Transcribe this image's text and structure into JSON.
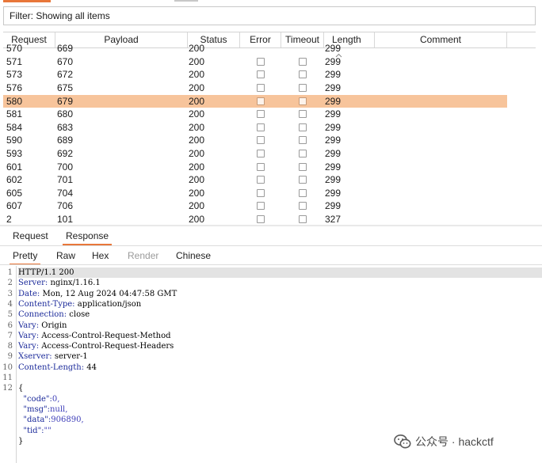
{
  "filter": {
    "label": "Filter: Showing all items"
  },
  "table": {
    "columns": [
      "Request",
      "Payload",
      "Status",
      "Error",
      "Timeout",
      "Length",
      "Comment"
    ],
    "sort_column": "Length",
    "partial_row": {
      "request": "570",
      "payload": "669",
      "status": "200",
      "length": "299"
    },
    "rows": [
      {
        "request": "571",
        "payload": "670",
        "status": "200",
        "error": false,
        "timeout": false,
        "length": "299",
        "selected": false
      },
      {
        "request": "573",
        "payload": "672",
        "status": "200",
        "error": false,
        "timeout": false,
        "length": "299",
        "selected": false
      },
      {
        "request": "576",
        "payload": "675",
        "status": "200",
        "error": false,
        "timeout": false,
        "length": "299",
        "selected": false
      },
      {
        "request": "580",
        "payload": "679",
        "status": "200",
        "error": false,
        "timeout": false,
        "length": "299",
        "selected": true
      },
      {
        "request": "581",
        "payload": "680",
        "status": "200",
        "error": false,
        "timeout": false,
        "length": "299",
        "selected": false
      },
      {
        "request": "584",
        "payload": "683",
        "status": "200",
        "error": false,
        "timeout": false,
        "length": "299",
        "selected": false
      },
      {
        "request": "590",
        "payload": "689",
        "status": "200",
        "error": false,
        "timeout": false,
        "length": "299",
        "selected": false
      },
      {
        "request": "593",
        "payload": "692",
        "status": "200",
        "error": false,
        "timeout": false,
        "length": "299",
        "selected": false
      },
      {
        "request": "601",
        "payload": "700",
        "status": "200",
        "error": false,
        "timeout": false,
        "length": "299",
        "selected": false
      },
      {
        "request": "602",
        "payload": "701",
        "status": "200",
        "error": false,
        "timeout": false,
        "length": "299",
        "selected": false
      },
      {
        "request": "605",
        "payload": "704",
        "status": "200",
        "error": false,
        "timeout": false,
        "length": "299",
        "selected": false
      },
      {
        "request": "607",
        "payload": "706",
        "status": "200",
        "error": false,
        "timeout": false,
        "length": "299",
        "selected": false
      },
      {
        "request": "2",
        "payload": "101",
        "status": "200",
        "error": false,
        "timeout": false,
        "length": "327",
        "selected": false
      }
    ]
  },
  "message_tabs": {
    "items": [
      "Request",
      "Response"
    ],
    "active": "Response"
  },
  "view_tabs": {
    "items": [
      "Pretty",
      "Raw",
      "Hex",
      "Render",
      "Chinese"
    ],
    "active": "Pretty",
    "disabled": [
      "Render"
    ]
  },
  "response_lines": [
    {
      "n": "1",
      "key": "HTTP/1.1 200",
      "val": ""
    },
    {
      "n": "2",
      "key": "Server:",
      "val": " nginx/1.16.1"
    },
    {
      "n": "3",
      "key": "Date:",
      "val": " Mon, 12 Aug 2024 04:47:58 GMT"
    },
    {
      "n": "4",
      "key": "Content-Type:",
      "val": " application/json"
    },
    {
      "n": "5",
      "key": "Connection:",
      "val": " close"
    },
    {
      "n": "6",
      "key": "Vary:",
      "val": " Origin"
    },
    {
      "n": "7",
      "key": "Vary:",
      "val": " Access-Control-Request-Method"
    },
    {
      "n": "8",
      "key": "Vary:",
      "val": " Access-Control-Request-Headers"
    },
    {
      "n": "9",
      "key": "Xserver:",
      "val": " server-1"
    },
    {
      "n": "10",
      "key": "Content-Length:",
      "val": " 44"
    },
    {
      "n": "11",
      "key": "",
      "val": ""
    },
    {
      "n": "12",
      "key": "{",
      "val": ""
    },
    {
      "n": "",
      "key": "  \"code\":",
      "val": "0,"
    },
    {
      "n": "",
      "key": "  \"msg\":",
      "val": "null,"
    },
    {
      "n": "",
      "key": "  \"data\":",
      "val": "906890,"
    },
    {
      "n": "",
      "key": "  \"tid\":",
      "val": "\"\""
    },
    {
      "n": "",
      "key": "}",
      "val": ""
    }
  ],
  "watermark": {
    "text": "公众号 · hackctf",
    "icon": "wechat-icon"
  },
  "colors": {
    "selected_row": "#f7c49b",
    "accent": "#e8773a"
  }
}
